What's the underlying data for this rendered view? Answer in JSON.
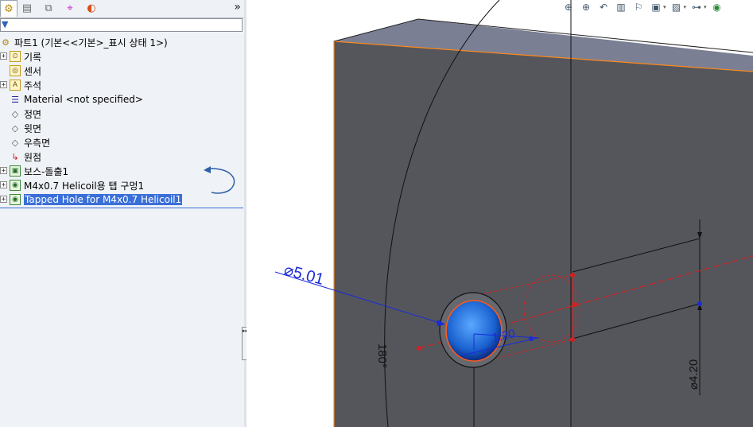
{
  "manager_tabs": {
    "items": [
      {
        "name": "feature-manager-tab",
        "glyph": "⚙"
      },
      {
        "name": "property-manager-tab",
        "glyph": "▤"
      },
      {
        "name": "configuration-manager-tab",
        "glyph": "⧉"
      },
      {
        "name": "dimxpert-manager-tab",
        "glyph": "⌖"
      },
      {
        "name": "display-manager-tab",
        "glyph": "◐"
      }
    ],
    "more": "»"
  },
  "filter": {
    "icon": "filter-icon",
    "glyph": "▼",
    "value": ""
  },
  "tree": {
    "root": "파트1  (기본<<기본>_표시 상태 1>)",
    "items": [
      {
        "label": "기록",
        "icon": "history-folder-icon",
        "glyph": "⏲",
        "expander": "+"
      },
      {
        "label": "센서",
        "icon": "sensor-icon",
        "glyph": "◎",
        "expander": ""
      },
      {
        "label": "주석",
        "icon": "annotation-icon",
        "glyph": "A",
        "expander": "+"
      },
      {
        "label": "Material <not specified>",
        "icon": "material-icon",
        "glyph": "☰",
        "expander": ""
      },
      {
        "label": "정면",
        "icon": "plane-icon",
        "glyph": "◇",
        "expander": ""
      },
      {
        "label": "윗면",
        "icon": "plane-icon",
        "glyph": "◇",
        "expander": ""
      },
      {
        "label": "우측면",
        "icon": "plane-icon",
        "glyph": "◇",
        "expander": ""
      },
      {
        "label": "원점",
        "icon": "origin-icon",
        "glyph": "↳",
        "expander": ""
      },
      {
        "label": "보스-돌출1",
        "icon": "boss-extrude-icon",
        "glyph": "▣",
        "expander": "+"
      },
      {
        "label": "M4x0.7 Helicoil용 탭 구멍1",
        "icon": "hole-wizard-icon",
        "glyph": "◉",
        "expander": "+"
      },
      {
        "label": "Tapped Hole for M4x0.7 Helicoil1",
        "icon": "hole-wizard-icon",
        "glyph": "◉",
        "expander": "+",
        "selected": true
      }
    ]
  },
  "splitter": {
    "glyph": "▸▸▸▸"
  },
  "view_toolbar": [
    {
      "name": "zoom-to-fit-icon",
      "glyph": "⊕"
    },
    {
      "name": "zoom-to-area-icon",
      "glyph": "⊕"
    },
    {
      "name": "previous-view-icon",
      "glyph": "↶"
    },
    {
      "name": "section-view-icon",
      "glyph": "▥"
    },
    {
      "name": "dynamic-annotation-views-icon",
      "glyph": "⚐"
    },
    {
      "name": "view-orientation-icon",
      "glyph": "▣",
      "caret": "▾"
    },
    {
      "name": "display-style-icon",
      "glyph": "▨",
      "caret": "▾"
    },
    {
      "name": "hide-show-items-icon",
      "glyph": "⊶",
      "caret": "▾"
    },
    {
      "name": "edit-appearance-icon",
      "glyph": "◉"
    }
  ],
  "dimensions": {
    "diameter_hole": "⌀5.01",
    "inner_dim": "1.20",
    "angle": "180°",
    "diameter_thread": "⌀4.20"
  },
  "colors": {
    "face": "#54565c",
    "top_face": "#7b7f94",
    "edge_highlight": "#ff8a1a",
    "dimension_blue": "#1a2bd8",
    "sketch_red": "#d42020",
    "selection_blue": "#3a6fd9"
  }
}
